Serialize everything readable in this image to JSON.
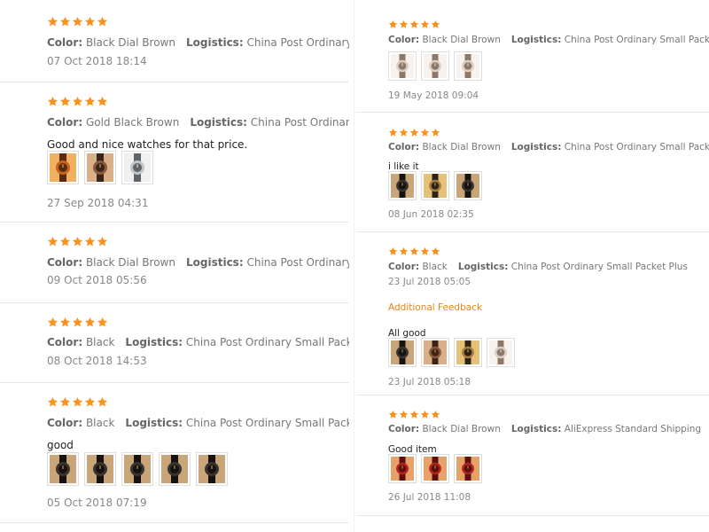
{
  "labels": {
    "color": "Color:",
    "logistics": "Logistics:"
  },
  "stars_color": "#f7931e",
  "left_reviews": [
    {
      "rating": 5,
      "color": "Black Dial Brown",
      "logistics": "China Post Ordinary Small Packet Plus",
      "comment": "",
      "photos": [],
      "date": "07 Oct 2018 18:14"
    },
    {
      "rating": 5,
      "color": "Gold Black Brown",
      "logistics": "China Post Ordinary Small Packet Plus",
      "comment": "Good and nice watches for that price.",
      "photos": [
        "watch-photo-orange",
        "watch-photo-brown",
        "watch-photo-white"
      ],
      "date": "27 Sep 2018 04:31"
    },
    {
      "rating": 5,
      "color": "Black Dial Brown",
      "logistics": "China Post Ordinary Small Packet Plus",
      "comment": "",
      "photos": [],
      "date": "09 Oct 2018 05:56"
    },
    {
      "rating": 5,
      "color": "Black",
      "logistics": "China Post Ordinary Small Packet Plus",
      "comment": "",
      "photos": [],
      "date": "08 Oct 2018 14:53"
    },
    {
      "rating": 5,
      "color": "Black",
      "logistics": "China Post Ordinary Small Packet Plus",
      "comment": "good",
      "photos": [
        "watch-photo-dark",
        "watch-photo-dark",
        "watch-photo-dark",
        "watch-photo-dark",
        "watch-photo-dark"
      ],
      "date": "05 Oct 2018 07:19"
    }
  ],
  "right_reviews": [
    {
      "rating": 5,
      "color": "Black Dial Brown",
      "logistics": "China Post Ordinary Small Packet Plus",
      "comment": "",
      "photos": [
        "watch-photo-light",
        "watch-photo-light",
        "watch-photo-light"
      ],
      "date": "19 May 2018 09:04"
    },
    {
      "rating": 5,
      "color": "Black Dial Brown",
      "logistics": "China Post Ordinary Small Packet Plus",
      "comment": "i like it",
      "photos": [
        "watch-photo-dark",
        "watch-photo-gold",
        "watch-photo-dark"
      ],
      "date": "08 Jun 2018 02:35"
    },
    {
      "rating": 5,
      "color": "Black",
      "logistics": "China Post Ordinary Small Packet Plus",
      "comment": "",
      "photos": [],
      "date": "23 Jul 2018 05:05",
      "additional": {
        "label": "Additional Feedback",
        "comment": "All good",
        "photos": [
          "watch-photo-dark",
          "watch-photo-brown",
          "watch-photo-gold",
          "watch-photo-light"
        ],
        "date": "23 Jul 2018 05:18"
      }
    },
    {
      "rating": 5,
      "color": "Black Dial Brown",
      "logistics": "AliExpress Standard Shipping",
      "comment": "Good item",
      "photos": [
        "watch-photo-red",
        "watch-photo-red",
        "watch-photo-red"
      ],
      "date": "26 Jul 2018 11:08"
    }
  ]
}
